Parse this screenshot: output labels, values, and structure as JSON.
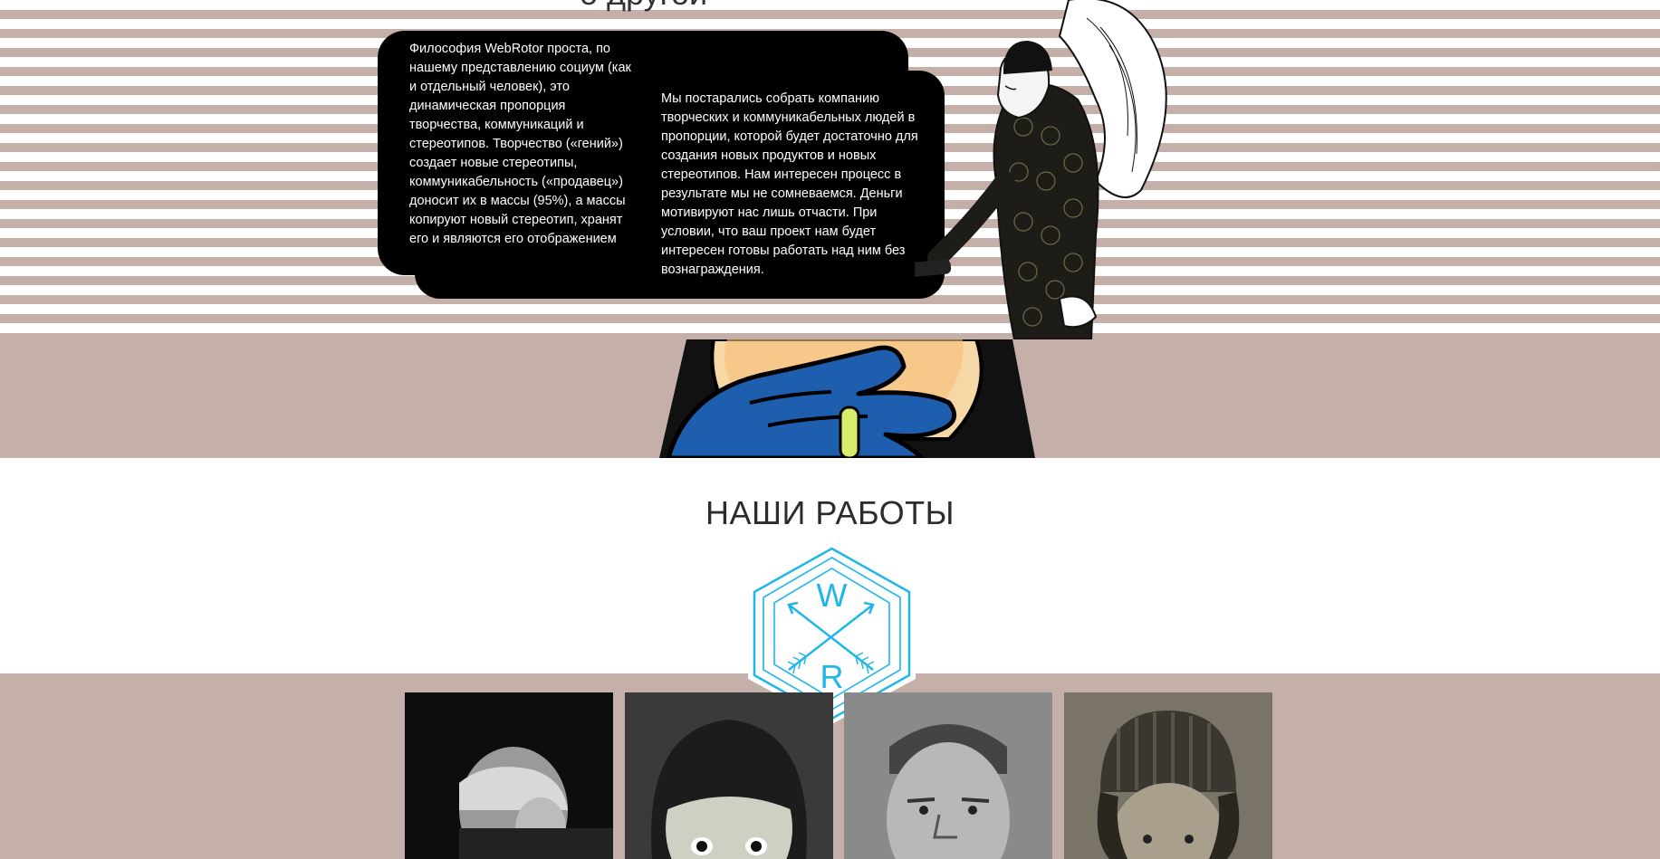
{
  "hero": {
    "cut_heading": "о другой",
    "bubble_left_text": "Философия WebRotor проста, по нашему представлению социум (как и отдельный человек), это динамическая пропорция творчества, коммуникаций и стереотипов. Творчество («гений») создает новые стереотипы, коммуникабельность («продавец») доносит их в массы (95%), а массы копируют новый стереотип, хранят его и являются его отображением",
    "bubble_right_text": "Мы постарались собрать компанию творческих и коммуникабельных людей в пропорции, которой будет достаточно для создания новых продуктов и новых стереотипов. Нам интересен процесс в результате мы не сомневаемся. Деньги мотивируют нас лишь отчасти. При условии, что ваш проект нам будет интересен готовы работать над ним без вознаграждения.",
    "illustration_icon": "angel-with-flashlight-illustration"
  },
  "comic_band": {
    "illustration_icon": "comic-hands-illustration"
  },
  "works": {
    "title": "НАШИ РАБОТЫ",
    "logo_letters": {
      "top": "W",
      "bottom": "R"
    },
    "logo_icon": "hexagon-arrows-logo-icon",
    "accent_color": "#1fb6e8",
    "photos": [
      {
        "icon": "portrait-old-man-smoking"
      },
      {
        "icon": "portrait-surprised-woman"
      },
      {
        "icon": "portrait-weathered-man"
      },
      {
        "icon": "portrait-man-knit-hat"
      }
    ]
  },
  "colors": {
    "stripe": "#c4b0a8",
    "band": "#c4b0a8",
    "bubble": "#000000",
    "title": "#2c2c2c"
  }
}
